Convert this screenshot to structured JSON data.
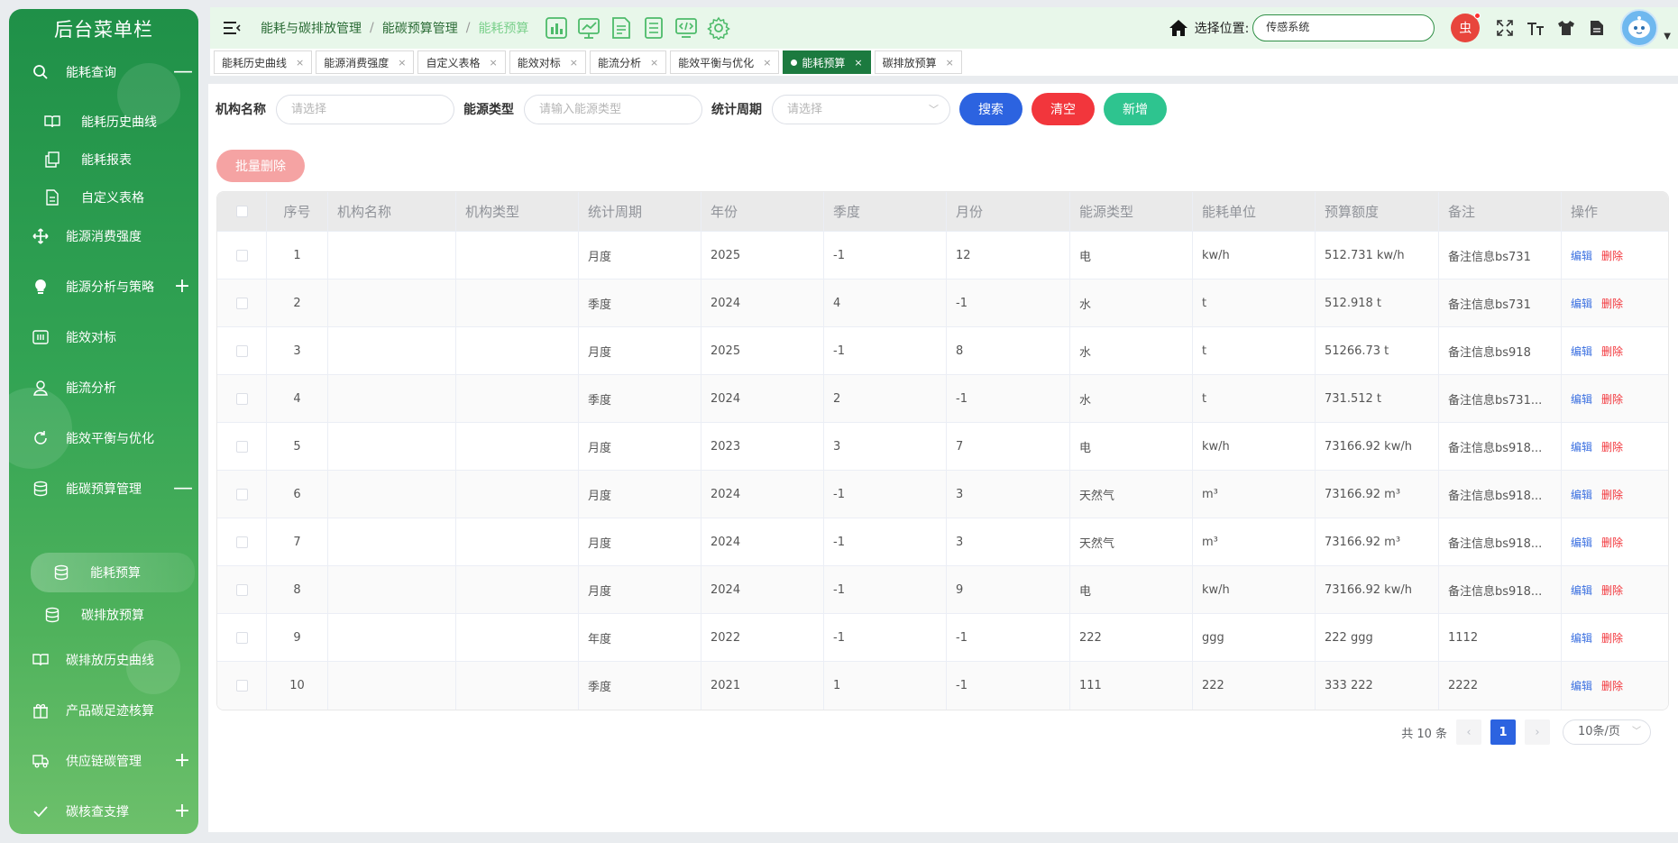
{
  "sidebar": {
    "title": "后台菜单栏",
    "items": [
      {
        "label": "能耗查询",
        "icon": "search-icon",
        "toggle": "—"
      },
      {
        "label": "能耗历史曲线",
        "icon": "book-icon"
      },
      {
        "label": "能耗报表",
        "icon": "copy-icon"
      },
      {
        "label": "自定义表格",
        "icon": "document-icon"
      },
      {
        "label": "能源消费强度",
        "icon": "move-icon"
      },
      {
        "label": "能源分析与策略",
        "icon": "bulb-icon",
        "toggle": "+"
      },
      {
        "label": "能效对标",
        "icon": "benchmark-icon"
      },
      {
        "label": "能流分析",
        "icon": "user-icon"
      },
      {
        "label": "能效平衡与优化",
        "icon": "refresh-icon"
      },
      {
        "label": "能碳预算管理",
        "icon": "database-icon",
        "toggle": "—"
      },
      {
        "label": "能耗预算",
        "icon": "database-icon"
      },
      {
        "label": "碳排放预算",
        "icon": "database-icon"
      },
      {
        "label": "碳排放历史曲线",
        "icon": "book-icon"
      },
      {
        "label": "产品碳足迹核算",
        "icon": "package-icon"
      },
      {
        "label": "供应链碳管理",
        "icon": "truck-icon",
        "toggle": "+"
      },
      {
        "label": "碳核查支撑",
        "icon": "check-icon",
        "toggle": "+"
      }
    ]
  },
  "header": {
    "breadcrumb": [
      "能耗与碳排放管理",
      "能碳预算管理",
      "能耗预算"
    ],
    "location_label": "选择位置:",
    "location_value": "传感系统",
    "bug_label": "虫"
  },
  "tabs": [
    {
      "label": "能耗历史曲线",
      "close": "×"
    },
    {
      "label": "能源消费强度",
      "close": "×"
    },
    {
      "label": "自定义表格",
      "close": "×"
    },
    {
      "label": "能效对标",
      "close": "×"
    },
    {
      "label": "能流分析",
      "close": "×"
    },
    {
      "label": "能效平衡与优化",
      "close": "×"
    },
    {
      "label": "能耗预算",
      "close": "×"
    },
    {
      "label": "碳排放预算",
      "close": "×"
    }
  ],
  "filters": {
    "org_label": "机构名称",
    "org_placeholder": "请选择",
    "energy_label": "能源类型",
    "energy_placeholder": "请输入能源类型",
    "period_label": "统计周期",
    "period_placeholder": "请选择",
    "caret": "﹀"
  },
  "buttons": {
    "search": "搜索",
    "clear": "清空",
    "add": "新增",
    "bulk_delete": "批量删除"
  },
  "table": {
    "headers": [
      "序号",
      "机构名称",
      "机构类型",
      "统计周期",
      "年份",
      "季度",
      "月份",
      "能源类型",
      "能耗单位",
      "预算额度",
      "备注",
      "操作"
    ],
    "edit_label": "编辑",
    "delete_label": "删除",
    "rows": [
      {
        "no": "1",
        "org": "",
        "orgtype": "",
        "period": "月度",
        "year": "2025",
        "quarter": "-1",
        "month": "12",
        "energy": "电",
        "unit": "kw/h",
        "budget": "512.731 kw/h",
        "note": "备注信息bs731"
      },
      {
        "no": "2",
        "org": "",
        "orgtype": "",
        "period": "季度",
        "year": "2024",
        "quarter": "4",
        "month": "-1",
        "energy": "水",
        "unit": "t",
        "budget": "512.918 t",
        "note": "备注信息bs731"
      },
      {
        "no": "3",
        "org": "",
        "orgtype": "",
        "period": "月度",
        "year": "2025",
        "quarter": "-1",
        "month": "8",
        "energy": "水",
        "unit": "t",
        "budget": "51266.73 t",
        "note": "备注信息bs918"
      },
      {
        "no": "4",
        "org": "",
        "orgtype": "",
        "period": "季度",
        "year": "2024",
        "quarter": "2",
        "month": "-1",
        "energy": "水",
        "unit": "t",
        "budget": "731.512 t",
        "note": "备注信息bs731..."
      },
      {
        "no": "5",
        "org": "",
        "orgtype": "",
        "period": "月度",
        "year": "2023",
        "quarter": "3",
        "month": "7",
        "energy": "电",
        "unit": "kw/h",
        "budget": "73166.92 kw/h",
        "note": "备注信息bs918..."
      },
      {
        "no": "6",
        "org": "",
        "orgtype": "",
        "period": "月度",
        "year": "2024",
        "quarter": "-1",
        "month": "3",
        "energy": "天然气",
        "unit": "m³",
        "budget": "73166.92 m³",
        "note": "备注信息bs918..."
      },
      {
        "no": "7",
        "org": "",
        "orgtype": "",
        "period": "月度",
        "year": "2024",
        "quarter": "-1",
        "month": "3",
        "energy": "天然气",
        "unit": "m³",
        "budget": "73166.92 m³",
        "note": "备注信息bs918..."
      },
      {
        "no": "8",
        "org": "",
        "orgtype": "",
        "period": "月度",
        "year": "2024",
        "quarter": "-1",
        "month": "9",
        "energy": "电",
        "unit": "kw/h",
        "budget": "73166.92 kw/h",
        "note": "备注信息bs918..."
      },
      {
        "no": "9",
        "org": "",
        "orgtype": "",
        "period": "年度",
        "year": "2022",
        "quarter": "-1",
        "month": "-1",
        "energy": "222",
        "unit": "ggg",
        "budget": "222 ggg",
        "note": "1112"
      },
      {
        "no": "10",
        "org": "",
        "orgtype": "",
        "period": "季度",
        "year": "2021",
        "quarter": "1",
        "month": "-1",
        "energy": "111",
        "unit": "222",
        "budget": "333 222",
        "note": "2222"
      }
    ]
  },
  "pagination": {
    "total": "共 10 条",
    "prev": "‹",
    "current_page": "1",
    "next": "›",
    "page_size": "10条/页"
  },
  "colors": {
    "primary_green": "#1c7a3f",
    "search_blue": "#2c63e0",
    "danger_red": "#f2363c",
    "success_teal": "#2ec48f"
  }
}
